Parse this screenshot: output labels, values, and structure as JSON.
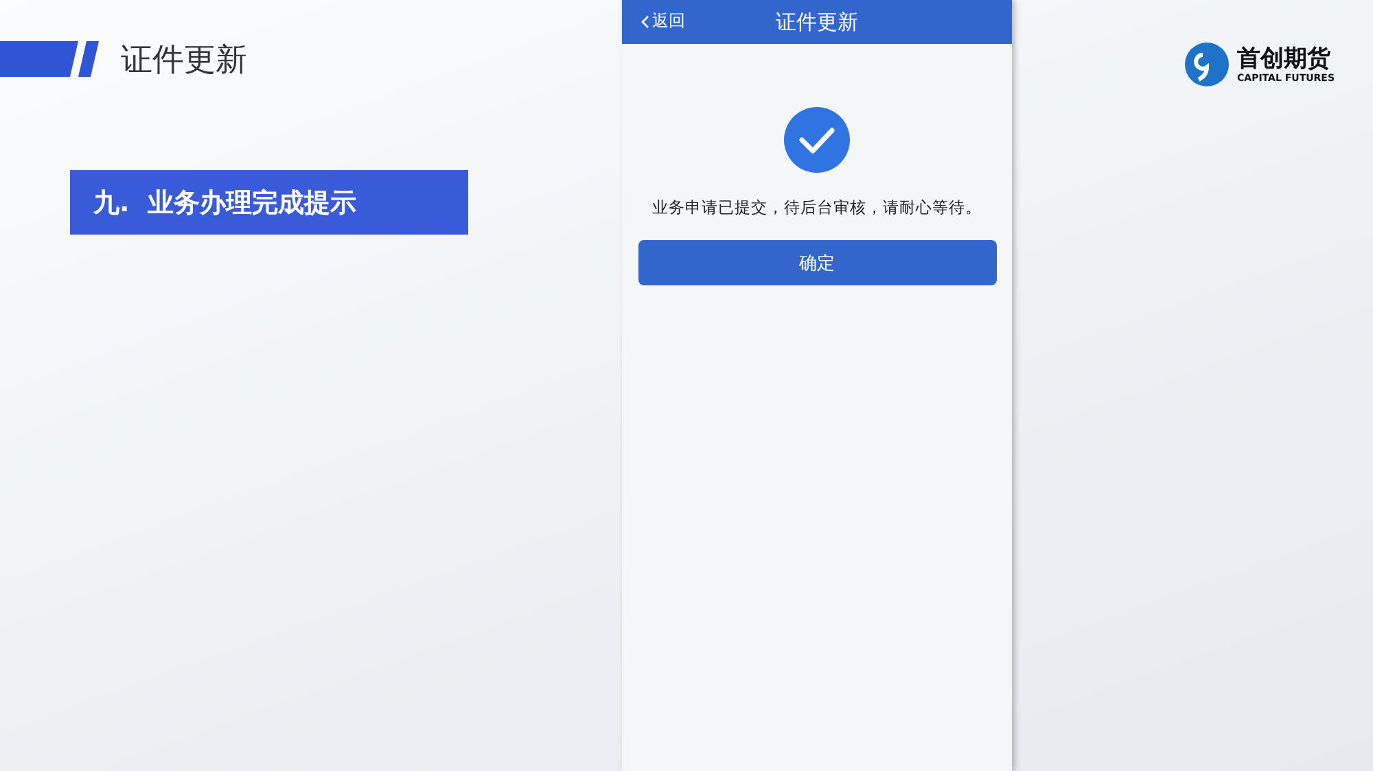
{
  "slide": {
    "title": "证件更新",
    "step_banner": "九.  业务办理完成提示"
  },
  "logo": {
    "name": "首创期货",
    "subtitle": "CAPITAL FUTURES"
  },
  "phone": {
    "back_label": "返回",
    "title": "证件更新",
    "message": "业务申请已提交，待后台审核，请耐心等待。",
    "confirm_button": "确定"
  }
}
